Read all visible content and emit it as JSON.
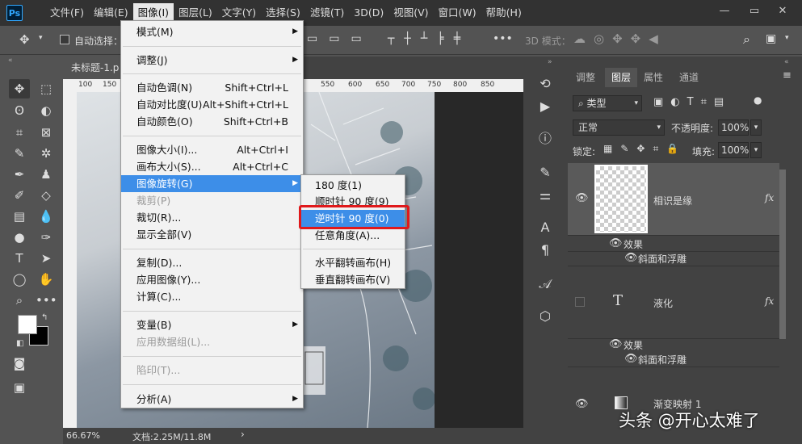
{
  "menubar": {
    "logo": "Ps",
    "items": [
      "文件(F)",
      "编辑(E)",
      "图像(I)",
      "图层(L)",
      "文字(Y)",
      "选择(S)",
      "滤镜(T)",
      "3D(D)",
      "视图(V)",
      "窗口(W)",
      "帮助(H)"
    ],
    "window_controls": {
      "minimize": "—",
      "restore": "▭",
      "close": "✕"
    }
  },
  "options": {
    "auto_select": "自动选择：",
    "mode_3d": "3D 模式："
  },
  "document": {
    "tab": "未标题-1.p",
    "zoom": "66.67%",
    "doc_info": "文档:2.25M/11.8M",
    "ruler_h": [
      "100",
      "150",
      "550",
      "600",
      "650",
      "700",
      "750",
      "800",
      "850"
    ]
  },
  "image_menu": {
    "items": [
      {
        "label": "模式(M)",
        "shortcut": "",
        "submenu": true,
        "disabled": false
      },
      {
        "label": "调整(J)",
        "shortcut": "",
        "submenu": true,
        "disabled": false
      },
      {
        "label": "自动色调(N)",
        "shortcut": "Shift+Ctrl+L",
        "submenu": false,
        "disabled": false
      },
      {
        "label": "自动对比度(U)",
        "shortcut": "Alt+Shift+Ctrl+L",
        "submenu": false,
        "disabled": false
      },
      {
        "label": "自动颜色(O)",
        "shortcut": "Shift+Ctrl+B",
        "submenu": false,
        "disabled": false
      },
      {
        "label": "图像大小(I)...",
        "shortcut": "Alt+Ctrl+I",
        "submenu": false,
        "disabled": false
      },
      {
        "label": "画布大小(S)...",
        "shortcut": "Alt+Ctrl+C",
        "submenu": false,
        "disabled": false
      },
      {
        "label": "图像旋转(G)",
        "shortcut": "",
        "submenu": true,
        "disabled": false,
        "highlighted": true
      },
      {
        "label": "裁剪(P)",
        "shortcut": "",
        "submenu": false,
        "disabled": true
      },
      {
        "label": "裁切(R)...",
        "shortcut": "",
        "submenu": false,
        "disabled": false
      },
      {
        "label": "显示全部(V)",
        "shortcut": "",
        "submenu": false,
        "disabled": false
      },
      {
        "label": "复制(D)...",
        "shortcut": "",
        "submenu": false,
        "disabled": false
      },
      {
        "label": "应用图像(Y)...",
        "shortcut": "",
        "submenu": false,
        "disabled": false
      },
      {
        "label": "计算(C)...",
        "shortcut": "",
        "submenu": false,
        "disabled": false
      },
      {
        "label": "变量(B)",
        "shortcut": "",
        "submenu": true,
        "disabled": false
      },
      {
        "label": "应用数据组(L)...",
        "shortcut": "",
        "submenu": false,
        "disabled": true
      },
      {
        "label": "陷印(T)...",
        "shortcut": "",
        "submenu": false,
        "disabled": true
      },
      {
        "label": "分析(A)",
        "shortcut": "",
        "submenu": true,
        "disabled": false
      }
    ]
  },
  "rotate_submenu": {
    "items": [
      {
        "label": "180 度(1)",
        "highlighted": false
      },
      {
        "label": "顺时针 90 度(9)",
        "highlighted": false
      },
      {
        "label": "逆时针 90 度(0)",
        "highlighted": true
      },
      {
        "label": "任意角度(A)...",
        "highlighted": false
      },
      {
        "label": "水平翻转画布(H)",
        "highlighted": false
      },
      {
        "label": "垂直翻转画布(V)",
        "highlighted": false
      }
    ]
  },
  "panel": {
    "tabs": [
      "调整",
      "图层",
      "属性",
      "通道"
    ],
    "filter_kind": "类型",
    "blend_mode": "正常",
    "opacity_label": "不透明度:",
    "opacity": "100%",
    "lock_label": "锁定:",
    "fill_label": "填充:",
    "fill": "100%",
    "layers": [
      {
        "name": "相识是缘",
        "fx": "fx",
        "effects_label": "效果",
        "effect": "斜面和浮雕"
      },
      {
        "name": "液化",
        "fx": "fx",
        "effects_label": "效果",
        "effect": "斜面和浮雕"
      },
      {
        "name": "渐变映射 1"
      }
    ]
  },
  "watermark": "头条 @开心太难了"
}
